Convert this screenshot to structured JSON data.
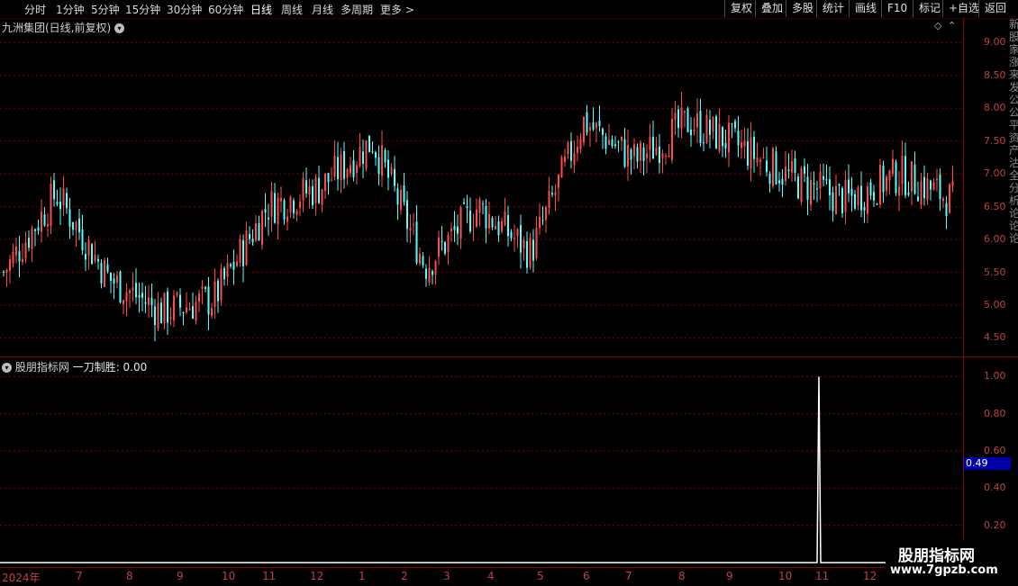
{
  "toolbar": {
    "periods": [
      "分时",
      "1分钟",
      "5分钟",
      "15分钟",
      "30分钟",
      "60分钟",
      "日线",
      "周线",
      "月线",
      "多周期",
      "更多 >"
    ],
    "active_period": "日线",
    "right_buttons": [
      "复权",
      "叠加",
      "多股",
      "统计",
      "画线",
      "F10",
      "标记",
      "+自选",
      "返回"
    ]
  },
  "main": {
    "title": "九洲集团(日线,前复权)"
  },
  "indicator": {
    "source": "股朋指标网",
    "name": "一刀制胜",
    "value": "0.00",
    "current": "0.49"
  },
  "axes": {
    "price_ticks": [
      "9.00",
      "8.50",
      "8.00",
      "7.50",
      "7.00",
      "6.50",
      "6.00",
      "5.50",
      "5.00",
      "4.50"
    ],
    "ind_ticks": [
      "1.00",
      "0.80",
      "0.60",
      "0.40",
      "0.20"
    ],
    "x_labels": [
      "2024年",
      "7",
      "8",
      "9",
      "10",
      "11",
      "12",
      "1",
      "2",
      "3",
      "4",
      "5",
      "6",
      "7",
      "8",
      "9",
      "10",
      "11",
      "12"
    ]
  },
  "side_text": "新股家涨来发公公平资产沽全分析论论论",
  "watermark": {
    "title": "股朋指标网",
    "url": "www.7gpzb.com"
  },
  "colors": {
    "up": "#ff4b4b",
    "down": "#54ffff",
    "grid": "#7a0000",
    "axis": "#c04040"
  },
  "chart_data": {
    "type": "candlestick",
    "title": "九洲集团(日线,前复权)",
    "ylim": [
      4.3,
      9.1
    ],
    "series": [
      {
        "name": "price",
        "x": [
          "2024-06",
          "2024-07",
          "2024-08",
          "2024-09",
          "2024-10",
          "2024-11",
          "2024-12",
          "2025-01",
          "2025-02",
          "2025-03",
          "2025-04",
          "2025-05",
          "2025-06",
          "2025-07",
          "2025-08",
          "2025-09",
          "2025-10",
          "2025-11",
          "2025-12"
        ],
        "close": [
          5.5,
          6.7,
          5.4,
          4.9,
          5.1,
          6.5,
          6.8,
          7.5,
          5.6,
          6.5,
          5.8,
          7.8,
          7.2,
          7.8,
          7.4,
          6.9,
          6.6,
          7.0,
          6.6
        ]
      }
    ],
    "indicator": {
      "name": "一刀制胜",
      "ylim": [
        0,
        1.05
      ],
      "spike_at": "2025-11",
      "spike_value": 1.0
    }
  }
}
